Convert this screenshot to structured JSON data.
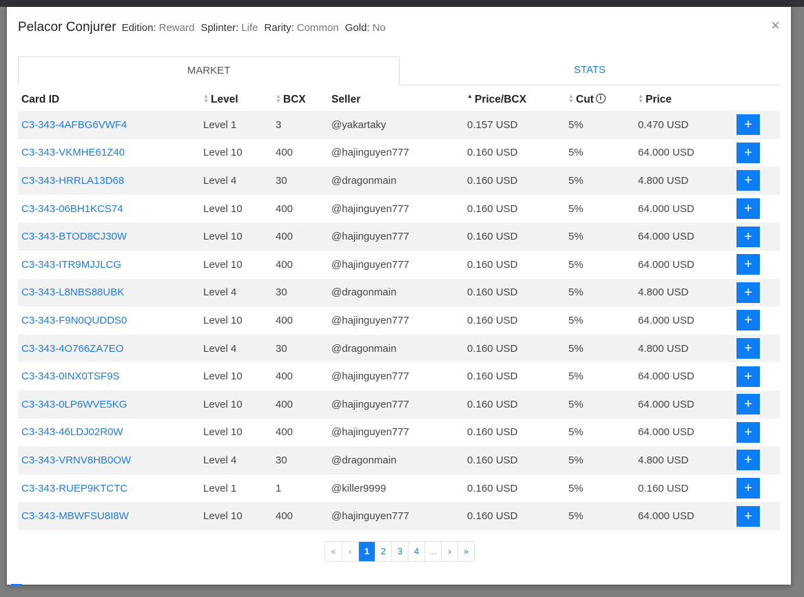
{
  "card": {
    "name": "Pelacor Conjurer",
    "edition_key": "Edition:",
    "edition": "Reward",
    "splinter_key": "Splinter:",
    "splinter": "Life",
    "rarity_key": "Rarity:",
    "rarity": "Common",
    "gold_key": "Gold:",
    "gold": "No"
  },
  "close_label": "×",
  "tabs": {
    "market": "MARKET",
    "stats": "STATS"
  },
  "columns": {
    "card_id": "Card ID",
    "level": "Level",
    "bcx": "BCX",
    "seller": "Seller",
    "price_bcx": "Price/BCX",
    "cut": "Cut",
    "price": "Price"
  },
  "add_label": "+",
  "rows": [
    {
      "id": "C3-343-4AFBG6VWF4",
      "level": "Level 1",
      "bcx": "3",
      "seller": "@yakartaky",
      "price_bcx": "0.157 USD",
      "cut": "5%",
      "price": "0.470 USD"
    },
    {
      "id": "C3-343-VKMHE61Z40",
      "level": "Level 10",
      "bcx": "400",
      "seller": "@hajinguyen777",
      "price_bcx": "0.160 USD",
      "cut": "5%",
      "price": "64.000 USD"
    },
    {
      "id": "C3-343-HRRLA13D68",
      "level": "Level 4",
      "bcx": "30",
      "seller": "@dragonmain",
      "price_bcx": "0.160 USD",
      "cut": "5%",
      "price": "4.800 USD"
    },
    {
      "id": "C3-343-06BH1KCS74",
      "level": "Level 10",
      "bcx": "400",
      "seller": "@hajinguyen777",
      "price_bcx": "0.160 USD",
      "cut": "5%",
      "price": "64.000 USD"
    },
    {
      "id": "C3-343-BTOD8CJ30W",
      "level": "Level 10",
      "bcx": "400",
      "seller": "@hajinguyen777",
      "price_bcx": "0.160 USD",
      "cut": "5%",
      "price": "64.000 USD"
    },
    {
      "id": "C3-343-ITR9MJJLCG",
      "level": "Level 10",
      "bcx": "400",
      "seller": "@hajinguyen777",
      "price_bcx": "0.160 USD",
      "cut": "5%",
      "price": "64.000 USD"
    },
    {
      "id": "C3-343-L8NBS88UBK",
      "level": "Level 4",
      "bcx": "30",
      "seller": "@dragonmain",
      "price_bcx": "0.160 USD",
      "cut": "5%",
      "price": "4.800 USD"
    },
    {
      "id": "C3-343-F9N0QUDDS0",
      "level": "Level 10",
      "bcx": "400",
      "seller": "@hajinguyen777",
      "price_bcx": "0.160 USD",
      "cut": "5%",
      "price": "64.000 USD"
    },
    {
      "id": "C3-343-4O766ZA7EO",
      "level": "Level 4",
      "bcx": "30",
      "seller": "@dragonmain",
      "price_bcx": "0.160 USD",
      "cut": "5%",
      "price": "4.800 USD"
    },
    {
      "id": "C3-343-0INX0TSF9S",
      "level": "Level 10",
      "bcx": "400",
      "seller": "@hajinguyen777",
      "price_bcx": "0.160 USD",
      "cut": "5%",
      "price": "64.000 USD"
    },
    {
      "id": "C3-343-0LP6WVE5KG",
      "level": "Level 10",
      "bcx": "400",
      "seller": "@hajinguyen777",
      "price_bcx": "0.160 USD",
      "cut": "5%",
      "price": "64.000 USD"
    },
    {
      "id": "C3-343-46LDJ02R0W",
      "level": "Level 10",
      "bcx": "400",
      "seller": "@hajinguyen777",
      "price_bcx": "0.160 USD",
      "cut": "5%",
      "price": "64.000 USD"
    },
    {
      "id": "C3-343-VRNV8HB0OW",
      "level": "Level 4",
      "bcx": "30",
      "seller": "@dragonmain",
      "price_bcx": "0.160 USD",
      "cut": "5%",
      "price": "4.800 USD"
    },
    {
      "id": "C3-343-RUEP9KTCTC",
      "level": "Level 1",
      "bcx": "1",
      "seller": "@killer9999",
      "price_bcx": "0.160 USD",
      "cut": "5%",
      "price": "0.160 USD"
    },
    {
      "id": "C3-343-MBWFSU8I8W",
      "level": "Level 10",
      "bcx": "400",
      "seller": "@hajinguyen777",
      "price_bcx": "0.160 USD",
      "cut": "5%",
      "price": "64.000 USD"
    }
  ],
  "pagination": {
    "first": "«",
    "prev": "‹",
    "pages": [
      "1",
      "2",
      "3",
      "4"
    ],
    "ellipsis": "...",
    "next": "›",
    "last": "»",
    "current": "1"
  },
  "colors": {
    "accent": "#0d7ef5",
    "link": "#1e7be8",
    "row_stripe": "#f2f2f2"
  }
}
